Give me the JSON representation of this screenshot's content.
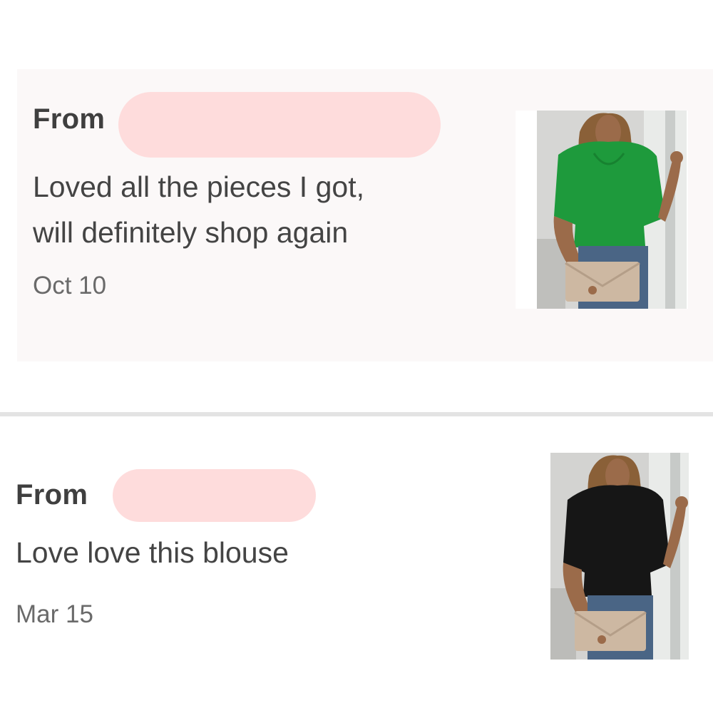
{
  "reviews": [
    {
      "from_label": "From",
      "text": "Loved all the pieces I got,\nwill definitely shop again",
      "date": "Oct 10",
      "product_icon": "green-blouse-photo",
      "highlight_color": "#fbf8f8"
    },
    {
      "from_label": "From",
      "text": "Love love this blouse",
      "date": "Mar 15",
      "product_icon": "black-blouse-photo"
    }
  ],
  "colors": {
    "redaction": "#fedcdc",
    "green_blouse": "#1e9a3c",
    "black_blouse": "#161616",
    "jeans": "#4a6585",
    "clutch": "#cdb8a2"
  }
}
